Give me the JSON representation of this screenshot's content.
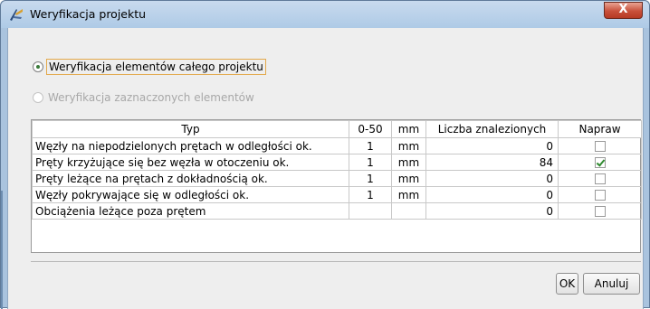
{
  "window": {
    "title": "Weryfikacja projektu",
    "close_label": "X"
  },
  "options": {
    "all_label": "Weryfikacja elementów całego projektu",
    "selected_label": "Weryfikacja zaznaczonych elementów",
    "checked": "all"
  },
  "table": {
    "headers": [
      "Typ",
      "0-50",
      "mm",
      "Liczba znalezionych",
      "Napraw"
    ],
    "rows": [
      {
        "typ": "Węzły na niepodzielonych prętach w odległości ok.",
        "value": "1",
        "unit": "mm",
        "count": "0",
        "fix": false
      },
      {
        "typ": "Pręty krzyżujące się bez węzła w otoczeniu ok.",
        "value": "1",
        "unit": "mm",
        "count": "84",
        "fix": true
      },
      {
        "typ": "Pręty leżące na prętach z dokładnością ok.",
        "value": "1",
        "unit": "mm",
        "count": "0",
        "fix": false
      },
      {
        "typ": "Węzły pokrywające się w odległości ok.",
        "value": "1",
        "unit": "mm",
        "count": "0",
        "fix": false
      },
      {
        "typ": "Obciążenia leżące poza prętem",
        "value": "",
        "unit": "",
        "count": "0",
        "fix": false
      }
    ]
  },
  "buttons": {
    "ok_label": "OK",
    "cancel_label": "Anuluj"
  },
  "colors": {
    "titlebar": "#aecae6",
    "close": "#c8503a",
    "focus_border": "#e3a94c",
    "check": "#2f8a2f"
  }
}
